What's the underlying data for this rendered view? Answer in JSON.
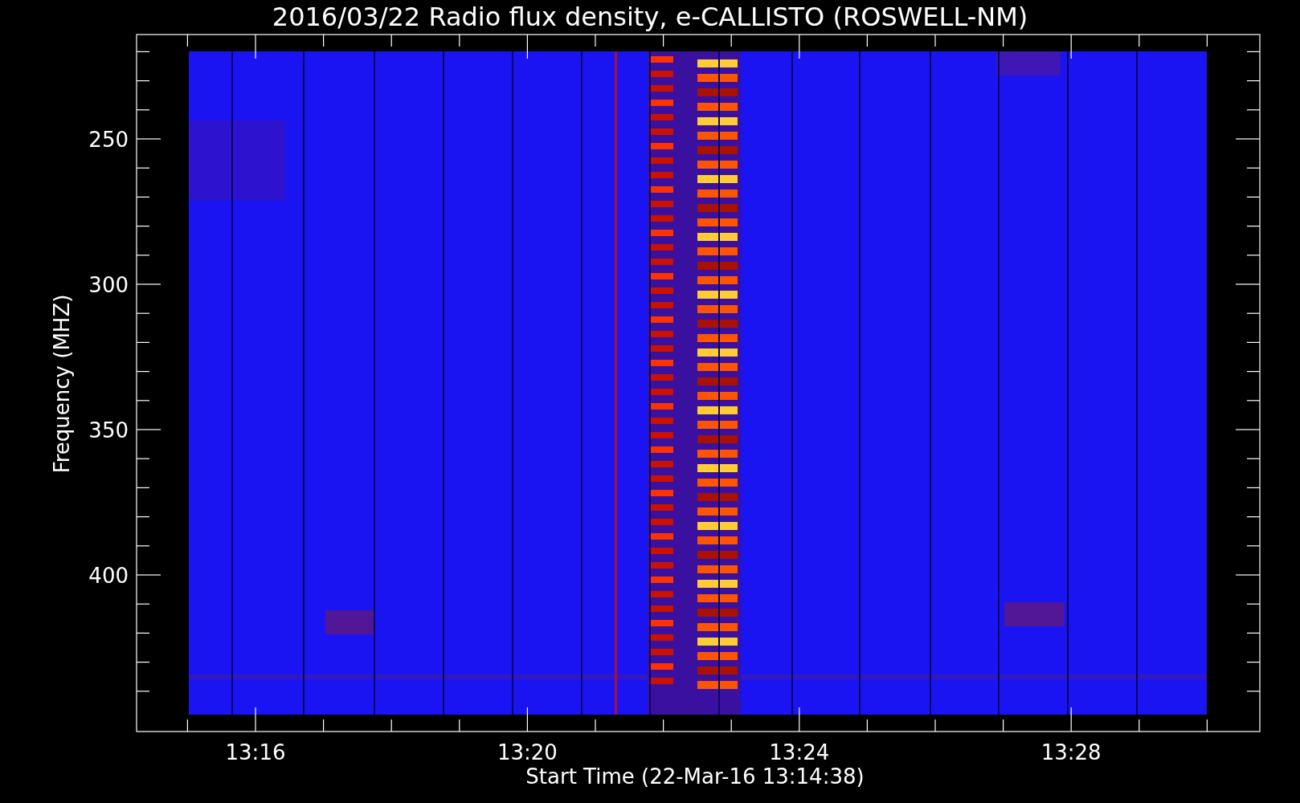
{
  "title": "2016/03/22  Radio flux density, e-CALLISTO (ROSWELL-NM)",
  "y_axis": {
    "label": "Frequency (MHZ)",
    "tick_labels": [
      "250",
      "300",
      "350",
      "400"
    ]
  },
  "x_axis": {
    "label": "Start Time (22-Mar-16 13:14:38)",
    "tick_labels": [
      "13:16",
      "13:20",
      "13:24",
      "13:28"
    ]
  }
}
